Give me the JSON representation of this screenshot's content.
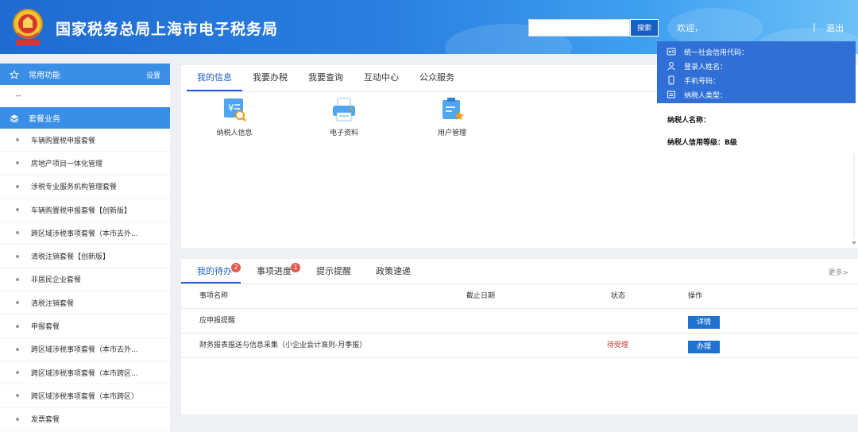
{
  "header": {
    "title": "国家税务总局上海市电子税务局",
    "search_placeholder": "",
    "search_button": "搜索",
    "welcome": "欢迎，",
    "separator": "|",
    "logout": "退出"
  },
  "user_popup": {
    "credit_code": "统一社会信用代码：",
    "login_name": "登录人姓名：",
    "phone": "手机号码：",
    "taxpayer_type": "纳税人类型："
  },
  "sidebar": {
    "common_functions": "常用功能",
    "settings": "设置",
    "empty_placeholder": "--",
    "packages_title": "套餐业务",
    "items": [
      {
        "label": "车辆购置税申报套餐"
      },
      {
        "label": "房地产项目一体化管理"
      },
      {
        "label": "涉税专业服务机构管理套餐"
      },
      {
        "label": "车辆购置税申报套餐【创新版】"
      },
      {
        "label": "跨区域涉税事项套餐（本市去外..."
      },
      {
        "label": "清税注销套餐【创新版】"
      },
      {
        "label": "非居民企业套餐"
      },
      {
        "label": "清税注销套餐"
      },
      {
        "label": "申报套餐"
      },
      {
        "label": "跨区域涉税事项套餐（本市去外..."
      },
      {
        "label": "跨区域涉税事项套餐（本市跨区..."
      },
      {
        "label": "跨区域涉税事项套餐（本市跨区）"
      },
      {
        "label": "发票套餐"
      }
    ]
  },
  "top_panel": {
    "tabs": [
      {
        "label": "我的信息"
      },
      {
        "label": "我要办税"
      },
      {
        "label": "我要查询"
      },
      {
        "label": "互动中心"
      },
      {
        "label": "公众服务"
      }
    ],
    "apps": [
      {
        "label": "纳税人信息"
      },
      {
        "label": "电子资料"
      },
      {
        "label": "用户管理"
      }
    ],
    "taxpayer_name_label": "纳税人名称：",
    "credit_level_label": "纳税人信用等级：B级"
  },
  "bottom_panel": {
    "tabs": [
      {
        "label": "我的待办",
        "badge": "2"
      },
      {
        "label": "事项进度",
        "badge": "1"
      },
      {
        "label": "提示提醒",
        "badge": ""
      },
      {
        "label": "政策速递",
        "badge": ""
      }
    ],
    "more": "更多>",
    "columns": {
      "name": "事项名称",
      "deadline": "截止日期",
      "status": "状态",
      "action": "操作"
    },
    "rows": [
      {
        "name": "应申报提醒",
        "deadline": "",
        "status": "",
        "action": "详情"
      },
      {
        "name": "财务报表报送与信息采集（小企业会计准则-月季报）",
        "deadline": "",
        "status": "待受理",
        "action": "办理"
      }
    ]
  },
  "colors": {
    "header_blue": "#2a7fe0",
    "accent": "#1f5fbf",
    "badge_red": "#e25b4f",
    "pending_red": "#c0392b"
  }
}
